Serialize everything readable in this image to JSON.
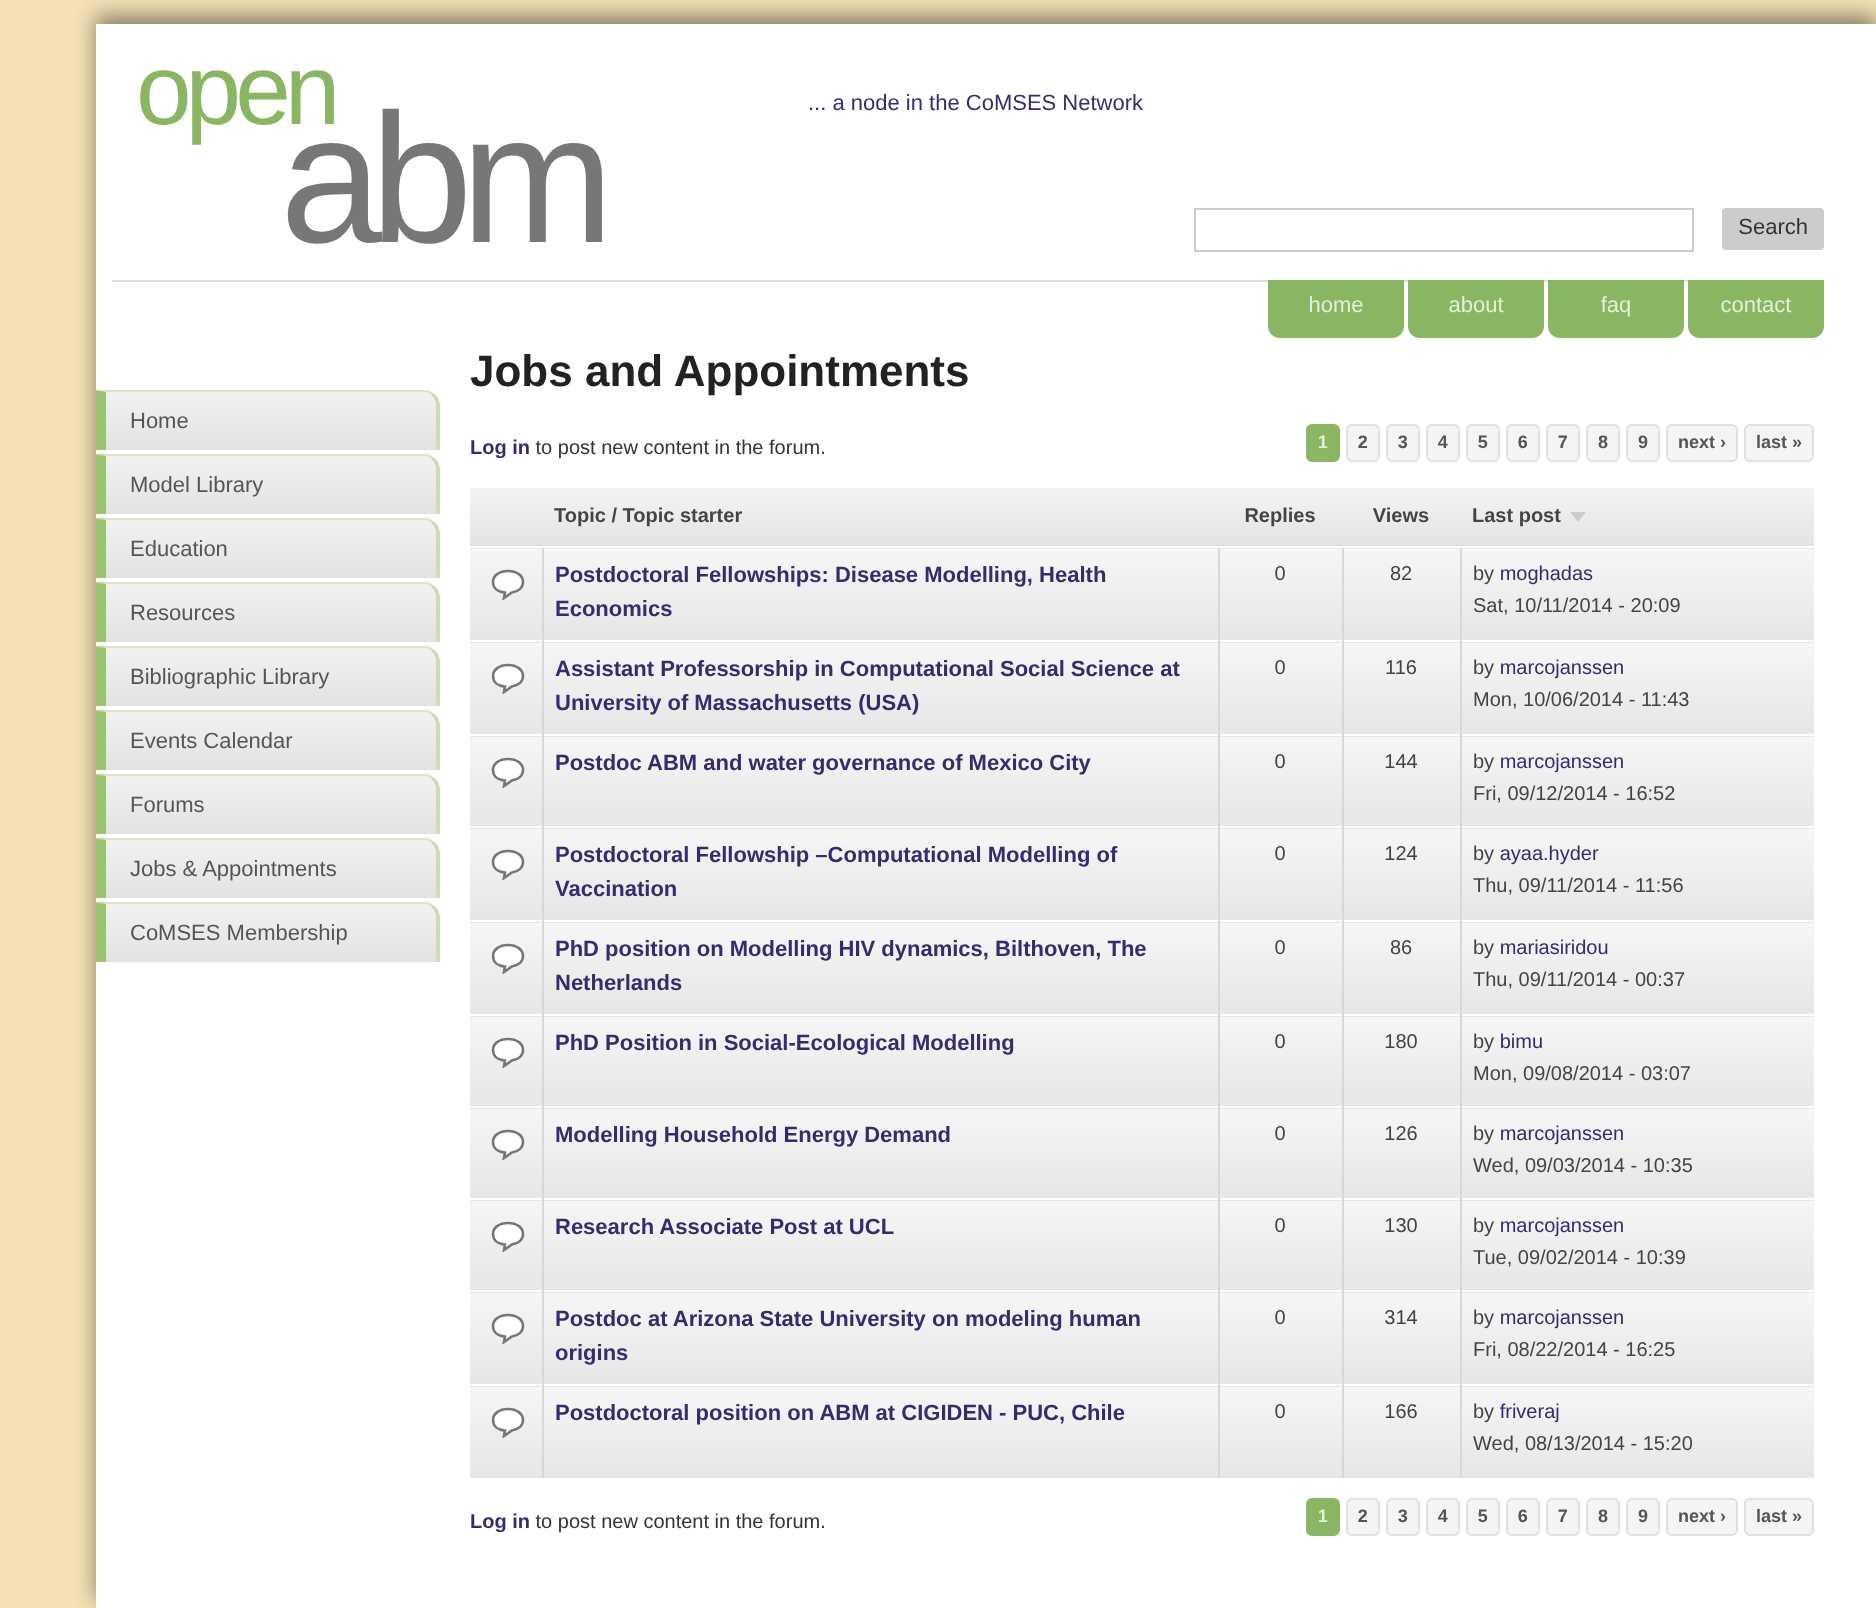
{
  "header": {
    "logo": {
      "top": "open",
      "bottom": "abm"
    },
    "tagline": "... a node in the CoMSES Network",
    "search": {
      "button": "Search"
    }
  },
  "top_nav": [
    "home",
    "about",
    "faq",
    "contact"
  ],
  "sidebar": {
    "items": [
      "Home",
      "Model Library",
      "Education",
      "Resources",
      "Bibliographic Library",
      "Events Calendar",
      "Forums",
      "Jobs & Appointments",
      "CoMSES Membership"
    ]
  },
  "page_title": "Jobs and Appointments",
  "login_notice_top": {
    "link": "Log in",
    "text": "to post new content in the forum."
  },
  "pager_top": {
    "pages": [
      {
        "label": "1",
        "selected": true
      },
      {
        "label": "2",
        "selected": false
      },
      {
        "label": "3",
        "selected": false
      },
      {
        "label": "4",
        "selected": false
      },
      {
        "label": "5",
        "selected": false
      },
      {
        "label": "6",
        "selected": false
      },
      {
        "label": "7",
        "selected": false
      },
      {
        "label": "8",
        "selected": false
      },
      {
        "label": "9",
        "selected": false
      }
    ],
    "next": "next ›",
    "last": "last »"
  },
  "table": {
    "columns": [
      "Topic / Topic starter",
      "Replies",
      "Views",
      "Last post"
    ],
    "rows": [
      {
        "topic": "Postdoctoral Fellowships: Disease Modelling, Health Economics",
        "replies": "0",
        "views": "82",
        "by": "by",
        "author": "moghadas",
        "date": "Sat, 10/11/2014 - 20:09"
      },
      {
        "topic": "Assistant Professorship in Computational Social Science at University of Massachusetts (USA)",
        "replies": "0",
        "views": "116",
        "by": "by",
        "author": "marcojanssen",
        "date": "Mon, 10/06/2014 - 11:43"
      },
      {
        "topic": "Postdoc ABM and water governance of Mexico City",
        "replies": "0",
        "views": "144",
        "by": "by",
        "author": "marcojanssen",
        "date": "Fri, 09/12/2014 - 16:52"
      },
      {
        "topic": "Postdoctoral Fellowship –Computational Modelling of Vaccination",
        "replies": "0",
        "views": "124",
        "by": "by",
        "author": "ayaa.hyder",
        "date": "Thu, 09/11/2014 - 11:56"
      },
      {
        "topic": "PhD position on Modelling HIV dynamics, Bilthoven, The Netherlands",
        "replies": "0",
        "views": "86",
        "by": "by",
        "author": "mariasiridou",
        "date": "Thu, 09/11/2014 - 00:37"
      },
      {
        "topic": "PhD Position in Social-Ecological Modelling",
        "replies": "0",
        "views": "180",
        "by": "by",
        "author": "bimu",
        "date": "Mon, 09/08/2014 - 03:07"
      },
      {
        "topic": "Modelling Household Energy Demand",
        "replies": "0",
        "views": "126",
        "by": "by",
        "author": "marcojanssen",
        "date": "Wed, 09/03/2014 - 10:35"
      },
      {
        "topic": "Research Associate Post at UCL",
        "replies": "0",
        "views": "130",
        "by": "by",
        "author": "marcojanssen",
        "date": "Tue, 09/02/2014 - 10:39"
      },
      {
        "topic": "Postdoc at Arizona State University on modeling human origins",
        "replies": "0",
        "views": "314",
        "by": "by",
        "author": "marcojanssen",
        "date": "Fri, 08/22/2014 - 16:25"
      },
      {
        "topic": "Postdoctoral position on ABM at CIGIDEN - PUC, Chile",
        "replies": "0",
        "views": "166",
        "by": "by",
        "author": "friveraj",
        "date": "Wed, 08/13/2014 - 15:20"
      }
    ]
  },
  "login_notice_bottom": {
    "link": "Log in",
    "text": "to post new content in the forum."
  },
  "pager_bottom": {
    "pages": [
      {
        "label": "1",
        "selected": true
      },
      {
        "label": "2",
        "selected": false
      },
      {
        "label": "3",
        "selected": false
      },
      {
        "label": "4",
        "selected": false
      },
      {
        "label": "5",
        "selected": false
      },
      {
        "label": "6",
        "selected": false
      },
      {
        "label": "7",
        "selected": false
      },
      {
        "label": "8",
        "selected": false
      },
      {
        "label": "9",
        "selected": false
      }
    ],
    "next": "next ›",
    "last": "last »"
  }
}
